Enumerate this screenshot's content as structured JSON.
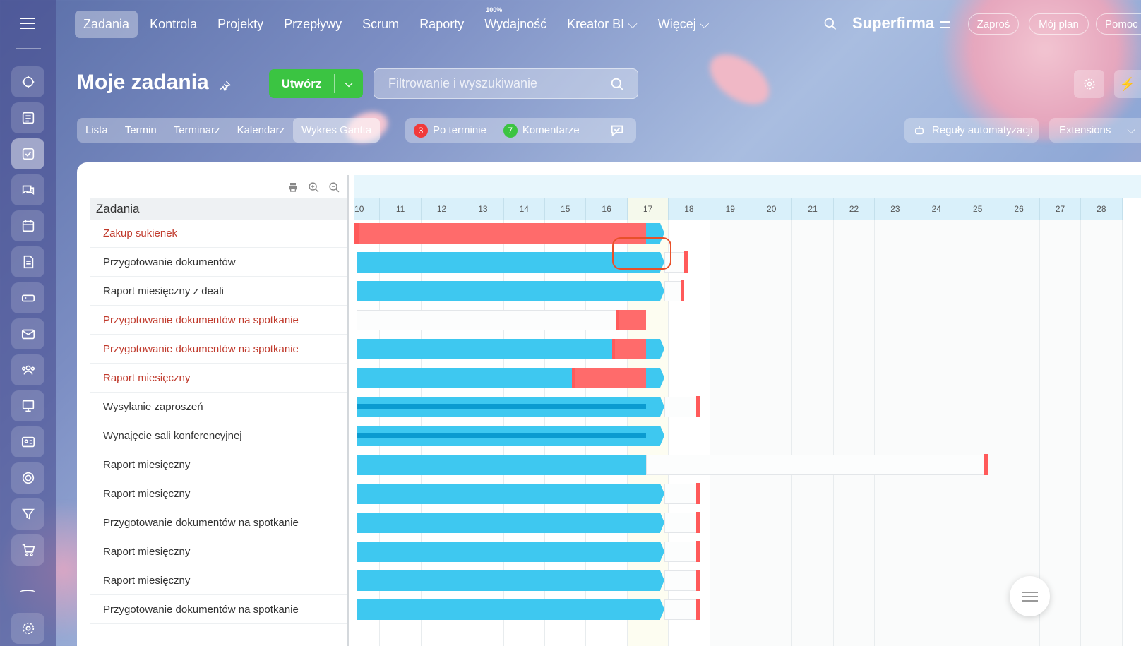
{
  "nav": {
    "items": [
      {
        "label": "Zadania"
      },
      {
        "label": "Kontrola"
      },
      {
        "label": "Projekty"
      },
      {
        "label": "Przepływy"
      },
      {
        "label": "Scrum"
      },
      {
        "label": "Raporty"
      },
      {
        "label": "Wydajność",
        "badge": "100%"
      },
      {
        "label": "Kreator BI ⌵"
      },
      {
        "label": "Więcej ⌵"
      }
    ],
    "company": "Superfirma",
    "invite": "Zaproś",
    "my_plan": "Mój plan",
    "help": "Pomoc"
  },
  "header": {
    "title": "Moje zadania",
    "create_label": "Utwórz",
    "search_placeholder": "Filtrowanie i wyszukiwanie"
  },
  "views": {
    "tabs": [
      {
        "label": "Lista"
      },
      {
        "label": "Termin"
      },
      {
        "label": "Terminarz"
      },
      {
        "label": "Kalendarz"
      },
      {
        "label": "Wykres Gantta"
      }
    ]
  },
  "counters": {
    "overdue_count": "3",
    "overdue_label": "Po terminie",
    "comments_count": "7",
    "comments_label": "Komentarze"
  },
  "right_tools": {
    "automation": "Reguły automatyzacji",
    "extensions": "Extensions"
  },
  "task_column": {
    "header": "Zadania"
  },
  "gantt": {
    "days": [
      "10",
      "11",
      "12",
      "13",
      "14",
      "15",
      "16",
      "17",
      "18",
      "19",
      "20",
      "21",
      "22",
      "23",
      "24",
      "25",
      "26",
      "27",
      "28"
    ]
  },
  "tasks": [
    {
      "name": "Zakup sukienek",
      "overdue": true
    },
    {
      "name": "Przygotowanie dokumentów",
      "overdue": false
    },
    {
      "name": "Raport miesięczny z deali",
      "overdue": false
    },
    {
      "name": "Przygotowanie dokumentów na spotkanie",
      "overdue": true
    },
    {
      "name": "Przygotowanie dokumentów na spotkanie",
      "overdue": true
    },
    {
      "name": "Raport miesięczny",
      "overdue": true
    },
    {
      "name": "Wysyłanie zaproszeń",
      "overdue": false
    },
    {
      "name": "Wynajęcie sali konferencyjnej",
      "overdue": false
    },
    {
      "name": "Raport miesięczny",
      "overdue": false
    },
    {
      "name": "Raport miesięczny",
      "overdue": false
    },
    {
      "name": "Przygotowanie dokumentów na spotkanie",
      "overdue": false
    },
    {
      "name": "Raport miesięczny",
      "overdue": false
    },
    {
      "name": "Raport miesięczny",
      "overdue": false
    },
    {
      "name": "Przygotowanie dokumentów na spotkanie",
      "overdue": false
    }
  ],
  "colors": {
    "accent_blue": "#3ec8f0",
    "overdue_red": "#ff6b6b",
    "create_green": "#3bc442",
    "overdue_text": "#c0392b"
  }
}
